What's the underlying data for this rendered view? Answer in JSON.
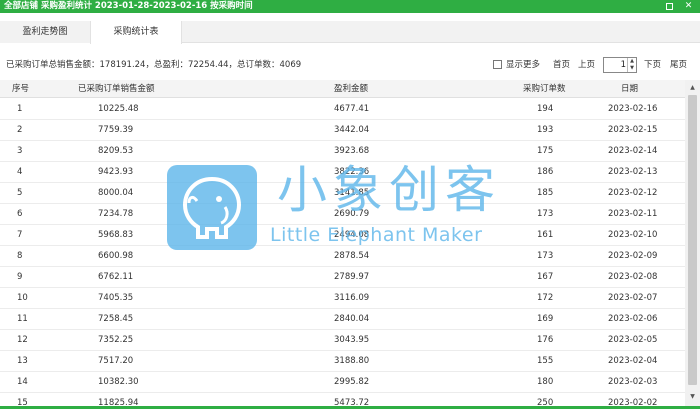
{
  "window": {
    "title": "全部店铺 采购盈利统计 2023-01-28-2023-02-16 按采购时间",
    "maximize_icon": "maximize-icon",
    "close_glyph": "✕"
  },
  "tabs": [
    {
      "label": "盈利走势图",
      "active": false
    },
    {
      "label": "采购统计表",
      "active": true
    }
  ],
  "summary": {
    "text": "已采购订单总销售金额：178191.24，总盈利：72254.44，总订单数：4069"
  },
  "pager": {
    "show_more_label": "显示更多",
    "first_label": "首页",
    "prev_label": "上页",
    "current_page": "1",
    "next_label": "下页",
    "last_label": "尾页"
  },
  "table": {
    "headers": [
      "序号",
      "已采购订单销售金额",
      "盈利金额",
      "采购订单数",
      "日期"
    ],
    "rows": [
      [
        "1",
        "10225.48",
        "4677.41",
        "194",
        "2023-02-16"
      ],
      [
        "2",
        "7759.39",
        "3442.04",
        "193",
        "2023-02-15"
      ],
      [
        "3",
        "8209.53",
        "3923.68",
        "175",
        "2023-02-14"
      ],
      [
        "4",
        "9423.93",
        "3822.36",
        "186",
        "2023-02-13"
      ],
      [
        "5",
        "8000.04",
        "3141.85",
        "185",
        "2023-02-12"
      ],
      [
        "6",
        "7234.78",
        "2690.79",
        "173",
        "2023-02-11"
      ],
      [
        "7",
        "5968.83",
        "2494.08",
        "161",
        "2023-02-10"
      ],
      [
        "8",
        "6600.98",
        "2878.54",
        "173",
        "2023-02-09"
      ],
      [
        "9",
        "6762.11",
        "2789.97",
        "167",
        "2023-02-08"
      ],
      [
        "10",
        "7405.35",
        "3116.09",
        "172",
        "2023-02-07"
      ],
      [
        "11",
        "7258.45",
        "2840.04",
        "169",
        "2023-02-06"
      ],
      [
        "12",
        "7352.25",
        "3043.95",
        "176",
        "2023-02-05"
      ],
      [
        "13",
        "7517.20",
        "3188.80",
        "155",
        "2023-02-04"
      ],
      [
        "14",
        "10382.30",
        "2995.82",
        "180",
        "2023-02-03"
      ],
      [
        "15",
        "11825.94",
        "5473.72",
        "250",
        "2023-02-02"
      ]
    ]
  },
  "watermark": {
    "text_cn": "小象创客",
    "text_en": "Little Elephant Maker",
    "logo_icon": "elephant-logo-icon"
  },
  "colors": {
    "accent": "#2fae43",
    "watermark": "#5db6ea"
  }
}
